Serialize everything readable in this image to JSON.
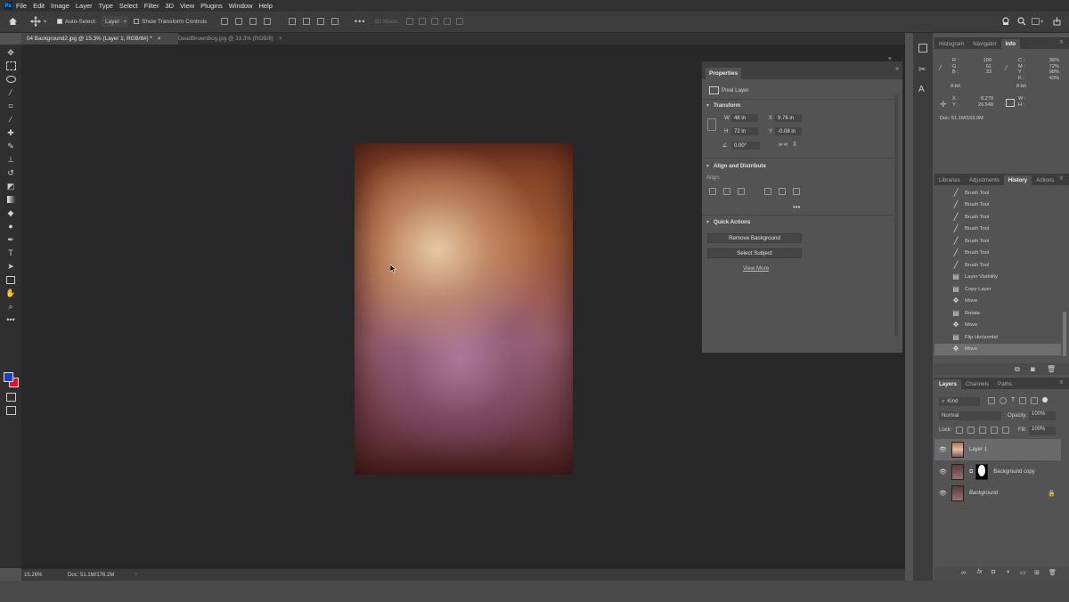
{
  "menu": {
    "app_icon": "Ps",
    "items": [
      "File",
      "Edit",
      "Image",
      "Layer",
      "Type",
      "Select",
      "Filter",
      "3D",
      "View",
      "Plugins",
      "Window",
      "Help"
    ]
  },
  "options": {
    "auto_select_label": "Auto-Select:",
    "auto_select_value": "Layer",
    "transform_controls_label": "Show Transform Controls",
    "more_label": "•••",
    "mode_3d": "3D Mode:"
  },
  "tabs": [
    {
      "label": "04 Background2.jpg @ 15.3% (Layer 1, RGB/8#) *",
      "close": "×"
    },
    {
      "label": "DeadBrownBog.jpg @ 33.3% (RGB/8)",
      "close": "×"
    }
  ],
  "status": {
    "zoom": "15.26%",
    "doc": "Doc: 51.1M/176.2M",
    "arrow": "›"
  },
  "properties": {
    "title": "Properties",
    "layer_type": "Pixel Layer",
    "transform_label": "Transform",
    "w_label": "W",
    "w_value": "48 in",
    "h_label": "H",
    "h_value": "72 in",
    "x_label": "X",
    "x_value": "9.76 in",
    "y_label": "Y",
    "y_value": "-0.08 in",
    "angle_value": "0.00°",
    "align_label": "Align and Distribute",
    "align_sub": "Align:",
    "more": "•••",
    "quick_actions_label": "Quick Actions",
    "btn_remove_bg": "Remove Background",
    "btn_select_subject": "Select Subject",
    "view_more": "View More"
  },
  "info_panel": {
    "tabs": [
      "Histogram",
      "Navigator",
      "Info"
    ],
    "active_tab": "Info",
    "rgb_labels": [
      "R :",
      "G :",
      "B :"
    ],
    "rgb_values": [
      "109",
      "61",
      "33"
    ],
    "cmyk_labels": [
      "C :",
      "M :",
      "Y :",
      "K :"
    ],
    "cmyk_values": [
      "36%",
      "72%",
      "98%",
      "43%"
    ],
    "bit_left": "8-bit",
    "bit_right": "8-bit",
    "x_label": "X :",
    "x_value": "8.279",
    "y_label": "Y :",
    "y_value": "26.548",
    "w_label": "W :",
    "h_label": "H :",
    "doc": "Doc: 51.1M/163.9M"
  },
  "history_panel": {
    "tabs": [
      "Libraries",
      "Adjustments",
      "History",
      "Actions"
    ],
    "active_tab": "History",
    "items": [
      {
        "label": "Brush Tool",
        "icon": "brush-icon"
      },
      {
        "label": "Brush Tool",
        "icon": "brush-icon"
      },
      {
        "label": "Brush Tool",
        "icon": "brush-icon"
      },
      {
        "label": "Brush Tool",
        "icon": "brush-icon"
      },
      {
        "label": "Brush Tool",
        "icon": "brush-icon"
      },
      {
        "label": "Brush Tool",
        "icon": "brush-icon"
      },
      {
        "label": "Brush Tool",
        "icon": "brush-icon"
      },
      {
        "label": "Layer Visibility",
        "icon": "layer-state-icon"
      },
      {
        "label": "Copy Layer",
        "icon": "layer-state-icon"
      },
      {
        "label": "Move",
        "icon": "move-icon"
      },
      {
        "label": "Rotate",
        "icon": "layer-state-icon"
      },
      {
        "label": "Move",
        "icon": "move-icon"
      },
      {
        "label": "Flip Horizontal",
        "icon": "layer-state-icon"
      },
      {
        "label": "Move",
        "icon": "move-icon"
      }
    ],
    "selected_index": 13
  },
  "layers_panel": {
    "tabs": [
      "Layers",
      "Channels",
      "Paths"
    ],
    "active_tab": "Layers",
    "filter_label": "Kind",
    "blend_mode": "Normal",
    "opacity_label": "Opacity:",
    "opacity_value": "100%",
    "lock_label": "Lock:",
    "fill_label": "Fill:",
    "fill_value": "100%",
    "layers": [
      {
        "name": "Layer 1",
        "selected": true
      },
      {
        "name": "Background copy",
        "selected": false
      },
      {
        "name": "Background",
        "selected": false
      }
    ]
  },
  "colors": {
    "foreground": "#1d3fb8",
    "background": "#e0122c"
  }
}
